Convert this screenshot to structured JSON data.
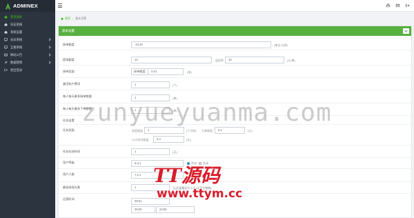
{
  "app": {
    "name": "ADMINEX"
  },
  "sidebar": {
    "items": [
      {
        "label": "管理面板"
      },
      {
        "label": "日志系统"
      },
      {
        "label": "系统设置"
      },
      {
        "label": "会员系统"
      },
      {
        "label": "互推系统"
      },
      {
        "label": "网站公告"
      },
      {
        "label": "数据管理"
      },
      {
        "label": "退出登录"
      }
    ]
  },
  "breadcrumb": {
    "home": "首页",
    "current": "基本设置"
  },
  "panel": {
    "title": "基本设置"
  },
  "form": {
    "r1": {
      "label": "接单额度",
      "value": "-10,20",
      "hint": "(单位:分钟)"
    },
    "r2": {
      "label": "提现额度",
      "value": "10",
      "mid_label": "返回率",
      "mid_value": "10",
      "hint": "(元/周)"
    },
    "r3": {
      "label": "接单奖励",
      "sub_label": "接单额度",
      "value": "0.01",
      "hint": "(张)"
    },
    "r4": {
      "label": "激活账户费用",
      "value": "1",
      "hint": "(个)"
    },
    "r5": {
      "label": "每人每天最多接单数量",
      "value": "1",
      "hint": "(单)"
    },
    "r6": {
      "label": "每人每天最多下单数量",
      "value": "1",
      "hint": "(单)"
    },
    "r7": {
      "label": "任务设置",
      "hint": ""
    },
    "r8": {
      "label": "任务奖励",
      "a_label": "实验收益",
      "a_value": "1",
      "a_hint": "(个小时)",
      "b_label": "订单收益",
      "b_value": "0.4",
      "b_hint": "(元)",
      "c_label": "12小时内收益",
      "c_value": "0.4",
      "c_hint": "(元)"
    },
    "r9": {
      "label": "任务在线时间",
      "value": "1",
      "hint": "(天)"
    },
    "r10": {
      "label": "用户等级",
      "value": "5,3,1",
      "radio_a": "开启",
      "radio_b": "关闭"
    },
    "r11": {
      "label": "用户人数",
      "value": "7,2,1"
    },
    "r12": {
      "label": "最低续保天数",
      "value": "1",
      "hint": "天(此值最低不小于1天且为整数)"
    },
    "r13": {
      "label": "运营时间",
      "start1": "09:01",
      "start2": "09:00",
      "end": "23:00"
    }
  },
  "watermarks": {
    "text1": "zunyueyuanma.com",
    "text2": "TT源码",
    "text3": "www.ttym.cc"
  },
  "colors": {
    "sidebar": "#2c343f",
    "accent": "#57b13f",
    "active_nav": "#3fb618",
    "watermark_red": "#d81d2b"
  }
}
